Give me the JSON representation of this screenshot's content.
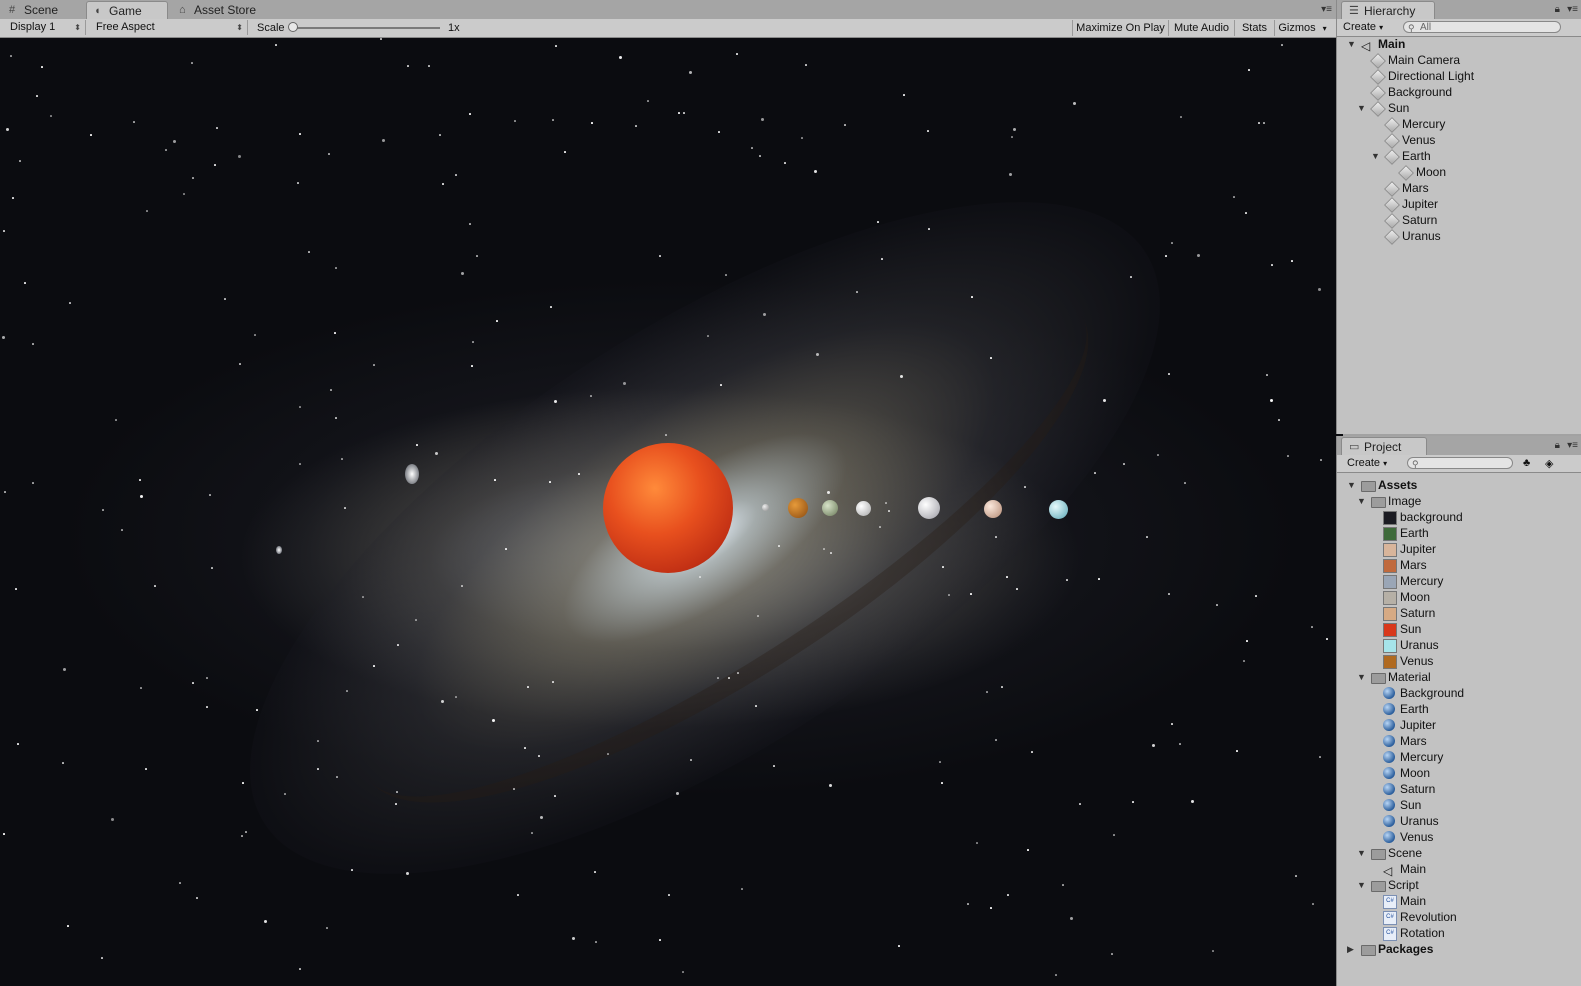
{
  "left_tabs": [
    "Scene",
    "Game",
    "Asset Store"
  ],
  "left_tab_icons": [
    "grid-icon",
    "pacman-icon",
    "shopping-bag-icon"
  ],
  "toolbar": {
    "display": "Display 1",
    "aspect": "Free Aspect",
    "scale_label": "Scale",
    "scale_value": "1x",
    "maximize": "Maximize On Play",
    "mute": "Mute Audio",
    "stats": "Stats",
    "gizmos": "Gizmos"
  },
  "hierarchy": {
    "tab": "Hierarchy",
    "create": "Create",
    "search_placeholder": "All",
    "scene_name": "Main",
    "items": [
      "Main Camera",
      "Directional Light",
      "Background",
      "Sun",
      "Mercury",
      "Venus",
      "Earth",
      "Moon",
      "Mars",
      "Jupiter",
      "Saturn",
      "Uranus"
    ]
  },
  "project": {
    "tab": "Project",
    "create": "Create",
    "assets": "Assets",
    "image_folder": "Image",
    "images": [
      "background",
      "Earth",
      "Jupiter",
      "Mars",
      "Mercury",
      "Moon",
      "Saturn",
      "Sun",
      "Uranus",
      "Venus"
    ],
    "image_colors": [
      "#1b1b22",
      "#3e6a3a",
      "#d9b59a",
      "#c06a3d",
      "#9aa6b6",
      "#b6b0a6",
      "#d6aa84",
      "#d9381b",
      "#a6e4ea",
      "#b06a20"
    ],
    "material_folder": "Material",
    "materials": [
      "Background",
      "Earth",
      "Jupiter",
      "Mars",
      "Mercury",
      "Moon",
      "Saturn",
      "Sun",
      "Uranus",
      "Venus"
    ],
    "scene_folder": "Scene",
    "scenes": [
      "Main"
    ],
    "script_folder": "Script",
    "scripts": [
      "Main",
      "Revolution",
      "Rotation"
    ],
    "packages": "Packages"
  },
  "colors": {
    "panel_bg": "#c2c2c2",
    "active_tab_bg": "#c8c8c8",
    "sun": "#e0401a",
    "material_blue": "#2b5e9c"
  }
}
